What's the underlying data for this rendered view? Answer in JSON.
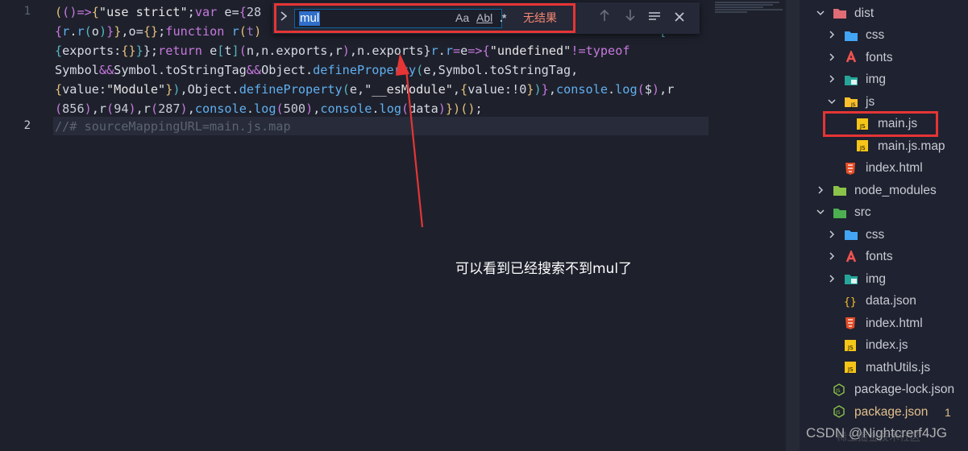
{
  "editor": {
    "line_numbers": [
      "1",
      "2"
    ],
    "line1_parts": [
      [
        "t-br1",
        "("
      ],
      [
        "t-br2",
        "("
      ],
      [
        "t-br2",
        ")"
      ],
      [
        "t-op",
        "=>"
      ],
      [
        "t-br1",
        "{"
      ],
      [
        "t-str",
        "\"use strict\""
      ],
      [
        "t-id",
        ";"
      ],
      [
        "t-kw",
        "var"
      ],
      [
        "t-id",
        " e="
      ],
      [
        "t-br2",
        "{"
      ],
      [
        "t-num",
        "28"
      ]
    ],
    "line2_parts": [
      [
        "t-br2",
        "{"
      ],
      [
        "t-fn",
        "r"
      ],
      [
        "t-id",
        "."
      ],
      [
        "t-fn",
        "r"
      ],
      [
        "t-br3",
        "("
      ],
      [
        "t-id",
        "o"
      ],
      [
        "t-br3",
        ")"
      ],
      [
        "t-br2",
        "}"
      ],
      [
        "t-br1",
        "}"
      ],
      [
        "t-id",
        ",o="
      ],
      [
        "t-br1",
        "{}"
      ],
      [
        "t-id",
        ";"
      ],
      [
        "t-kw",
        "function"
      ],
      [
        "t-id",
        " "
      ],
      [
        "t-fn",
        "r"
      ],
      [
        "t-br1",
        "("
      ],
      [
        "t-pur",
        "t"
      ],
      [
        "t-br1",
        ")"
      ]
    ],
    "line2_tail": [
      [
        "t-br3",
        "["
      ]
    ],
    "line3_parts": [
      [
        "t-br3",
        "{"
      ],
      [
        "t-id",
        "exports:"
      ],
      [
        "t-br1",
        "{}"
      ],
      [
        "t-br3",
        "}"
      ],
      [
        "t-id",
        "};"
      ],
      [
        "t-kw",
        "return"
      ],
      [
        "t-id",
        " e"
      ],
      [
        "t-br3",
        "["
      ],
      [
        "t-id",
        "t"
      ],
      [
        "t-br3",
        "]"
      ],
      [
        "t-br2",
        "("
      ],
      [
        "t-id",
        "n,n.exports,r"
      ],
      [
        "t-br2",
        ")"
      ],
      [
        "t-id",
        ","
      ],
      [
        "t-prop",
        "n.exports"
      ],
      [
        "t-id",
        "}"
      ],
      [
        "t-fn",
        "r"
      ],
      [
        "t-id",
        "."
      ],
      [
        "t-fn",
        "r"
      ],
      [
        "t-op",
        "="
      ],
      [
        "t-id",
        "e"
      ],
      [
        "t-op",
        "=>"
      ],
      [
        "t-br2",
        "{"
      ],
      [
        "t-str",
        "\"undefined\""
      ],
      [
        "t-op",
        "!="
      ],
      [
        "t-kw",
        "typeof"
      ]
    ],
    "line4_parts": [
      [
        "t-cls",
        "Symbol"
      ],
      [
        "t-op",
        "&&"
      ],
      [
        "t-cls",
        "Symbol"
      ],
      [
        "t-id",
        ".toStringTag"
      ],
      [
        "t-op",
        "&&"
      ],
      [
        "t-cls",
        "Object"
      ],
      [
        "t-id",
        "."
      ],
      [
        "t-fn",
        "defineProperty"
      ],
      [
        "t-br3",
        "("
      ],
      [
        "t-id",
        "e,"
      ],
      [
        "t-cls",
        "Symbol"
      ],
      [
        "t-id",
        ".toStringTag,"
      ]
    ],
    "line5_parts": [
      [
        "t-br1",
        "{"
      ],
      [
        "t-id",
        "value:"
      ],
      [
        "t-str",
        "\"Module\""
      ],
      [
        "t-br1",
        "}"
      ],
      [
        "t-br3",
        ")"
      ],
      [
        "t-id",
        ","
      ],
      [
        "t-cls",
        "Object"
      ],
      [
        "t-id",
        "."
      ],
      [
        "t-fn",
        "defineProperty"
      ],
      [
        "t-br3",
        "("
      ],
      [
        "t-id",
        "e,"
      ],
      [
        "t-str",
        "\"__esModule\""
      ],
      [
        "t-id",
        ","
      ],
      [
        "t-br1",
        "{"
      ],
      [
        "t-id",
        "value:!0"
      ],
      [
        "t-br1",
        "}"
      ],
      [
        "t-br3",
        ")"
      ],
      [
        "t-br2",
        "}"
      ],
      [
        "t-id",
        ","
      ],
      [
        "t-fn",
        "console"
      ],
      [
        "t-id",
        "."
      ],
      [
        "t-fn",
        "log"
      ],
      [
        "t-br2",
        "("
      ],
      [
        "t-id",
        "$"
      ],
      [
        "t-br2",
        ")"
      ],
      [
        "t-id",
        ",r"
      ]
    ],
    "line6_parts": [
      [
        "t-br2",
        "("
      ],
      [
        "t-num",
        "856"
      ],
      [
        "t-br2",
        ")"
      ],
      [
        "t-id",
        ",r"
      ],
      [
        "t-br2",
        "("
      ],
      [
        "t-num",
        "94"
      ],
      [
        "t-br2",
        ")"
      ],
      [
        "t-id",
        ",r"
      ],
      [
        "t-br2",
        "("
      ],
      [
        "t-num",
        "287"
      ],
      [
        "t-br2",
        ")"
      ],
      [
        "t-id",
        ","
      ],
      [
        "t-fn",
        "console"
      ],
      [
        "t-id",
        "."
      ],
      [
        "t-fn",
        "log"
      ],
      [
        "t-br2",
        "("
      ],
      [
        "t-num",
        "500"
      ],
      [
        "t-br2",
        ")"
      ],
      [
        "t-id",
        ","
      ],
      [
        "t-fn",
        "console"
      ],
      [
        "t-id",
        "."
      ],
      [
        "t-fn",
        "log"
      ],
      [
        "t-br2",
        "("
      ],
      [
        "t-id",
        "data"
      ],
      [
        "t-br2",
        ")"
      ],
      [
        "t-br1",
        "}"
      ],
      [
        "t-br1",
        ")"
      ],
      [
        "t-br1",
        "()"
      ],
      [
        "t-id",
        ";"
      ]
    ],
    "comment_line": "//# sourceMappingURL=main.js.map"
  },
  "find": {
    "query": "mul",
    "match_case": "Aa",
    "whole_word": "Abl",
    "regex": ".*",
    "status": "无结果"
  },
  "annotation": "可以看到已经搜索不到mul了",
  "explorer": {
    "items": [
      {
        "label": "dist",
        "depth": 1,
        "chev": "v",
        "icon": "folder-red-open"
      },
      {
        "label": "css",
        "depth": 2,
        "chev": ">",
        "icon": "folder-blue"
      },
      {
        "label": "fonts",
        "depth": 2,
        "chev": ">",
        "icon": "folder-red-a"
      },
      {
        "label": "img",
        "depth": 2,
        "chev": ">",
        "icon": "folder-green-img"
      },
      {
        "label": "js",
        "depth": 2,
        "chev": "v",
        "icon": "folder-js-open"
      },
      {
        "label": "main.js",
        "depth": 3,
        "chev": "",
        "icon": "js-file"
      },
      {
        "label": "main.js.map",
        "depth": 3,
        "chev": "",
        "icon": "js-file"
      },
      {
        "label": "index.html",
        "depth": 2,
        "chev": "",
        "icon": "html-file"
      },
      {
        "label": "node_modules",
        "depth": 1,
        "chev": ">",
        "icon": "folder-node"
      },
      {
        "label": "src",
        "depth": 1,
        "chev": "v",
        "icon": "folder-green-open"
      },
      {
        "label": "css",
        "depth": 2,
        "chev": ">",
        "icon": "folder-blue"
      },
      {
        "label": "fonts",
        "depth": 2,
        "chev": ">",
        "icon": "folder-red-a"
      },
      {
        "label": "img",
        "depth": 2,
        "chev": ">",
        "icon": "folder-green-img"
      },
      {
        "label": "data.json",
        "depth": 2,
        "chev": "",
        "icon": "json-file"
      },
      {
        "label": "index.html",
        "depth": 2,
        "chev": "",
        "icon": "html-file"
      },
      {
        "label": "index.js",
        "depth": 2,
        "chev": "",
        "icon": "js-file"
      },
      {
        "label": "mathUtils.js",
        "depth": 2,
        "chev": "",
        "icon": "js-file"
      },
      {
        "label": "package-lock.json",
        "depth": 1,
        "chev": "",
        "icon": "node-file"
      },
      {
        "label": "package.json",
        "depth": 1,
        "chev": "",
        "icon": "node-file",
        "badge": "1",
        "warn": true
      }
    ]
  },
  "watermark": {
    "main": "CSDN @Nightcrerf4JG",
    "secondary": "稀土掘金技术社区"
  },
  "colors": {
    "highlight": "#e53535",
    "accent": "#0e639c",
    "no_result": "#f48771"
  }
}
